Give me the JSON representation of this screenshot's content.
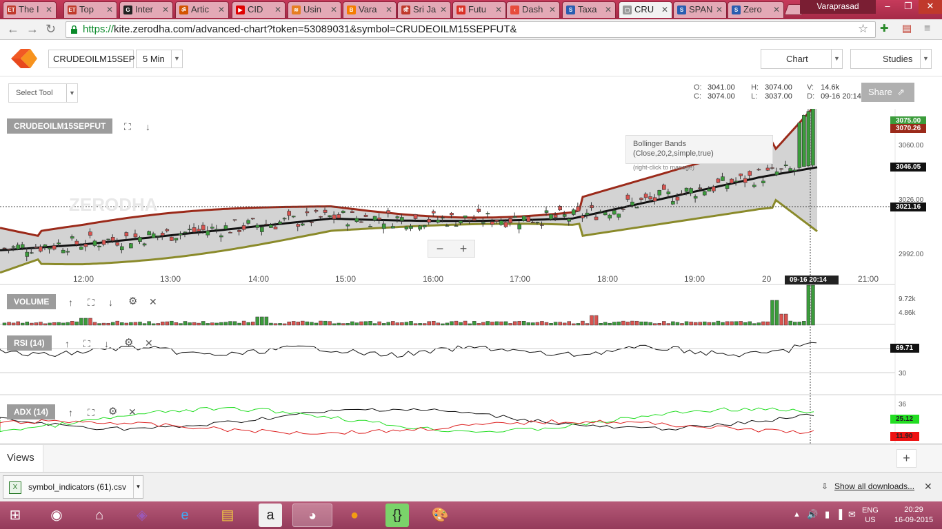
{
  "browser": {
    "tabs": [
      {
        "label": "The I",
        "icon": "ET",
        "color": "#c0392b"
      },
      {
        "label": "Top",
        "icon": "ET",
        "color": "#c0392b"
      },
      {
        "label": "Inter",
        "icon": "G",
        "color": "#222222"
      },
      {
        "label": "Artic",
        "icon": "ॐ",
        "color": "#d35400"
      },
      {
        "label": "CID",
        "icon": "▶",
        "color": "#e00000"
      },
      {
        "label": "Usin",
        "icon": "≋",
        "color": "#e67e22"
      },
      {
        "label": "Vara",
        "icon": "B",
        "color": "#f57d00"
      },
      {
        "label": "Sri Ja",
        "icon": "श्री",
        "color": "#c0392b"
      },
      {
        "label": "Futu",
        "icon": "M",
        "color": "#d93025"
      },
      {
        "label": "Dash",
        "icon": "‹",
        "color": "#e74c3c"
      },
      {
        "label": "Taxa",
        "icon": "S",
        "color": "#2a5db0"
      },
      {
        "label": "CRU",
        "icon": "▢",
        "color": "#999999"
      },
      {
        "label": "SPAN",
        "icon": "S",
        "color": "#2a5db0"
      },
      {
        "label": "Zero",
        "icon": "S",
        "color": "#2a5db0"
      }
    ],
    "user": "Varaprasad",
    "url_scheme": "https://",
    "url_rest": "kite.zerodha.com/advanced-chart?token=53089031&symbol=CRUDEOILM15SEPFUT&"
  },
  "app": {
    "symbol_input": "CRUDEOILM15SEP",
    "interval": "5 Min",
    "chart_btn": "Chart",
    "studies_btn": "Studies",
    "select_tool": "Select Tool",
    "share": "Share",
    "ohlc": {
      "o_label": "O:",
      "o": "3041.00",
      "h_label": "H:",
      "h": "3074.00",
      "v_label": "V:",
      "v": "14.6k",
      "c_label": "C:",
      "c": "3074.00",
      "l_label": "L:",
      "l": "3037.00",
      "d_label": "D:",
      "d": "09-16 20:14"
    },
    "panels": {
      "main": "CRUDEOILM15SEPFUT",
      "volume": "VOLUME",
      "rsi": "RSI (14)",
      "adx": "ADX (14)"
    },
    "tooltip": {
      "title": "Bollinger Bands (Close,20,2,simple,true)",
      "sub": "(right-click to manage)"
    },
    "zoom_minus": "−",
    "zoom_plus": "+",
    "views": "Views",
    "add_view": "+"
  },
  "chart_data": {
    "type": "candlestick",
    "time_labels": [
      "12:00",
      "13:00",
      "14:00",
      "15:00",
      "16:00",
      "17:00",
      "18:00",
      "19:00",
      "20",
      "21:00"
    ],
    "price_ticks": [
      "3060.00",
      "3026.00",
      "2992.00"
    ],
    "price_tags": {
      "last": "3075.00",
      "upper_band": "3070.26",
      "middle_band": "3046.05",
      "crosshair": "3021.16"
    },
    "crosshair_time": "09-16 20:14",
    "volume_ticks": [
      "9.72k",
      "4.86k"
    ],
    "rsi_ticks": [
      "30"
    ],
    "rsi_value": "69.71",
    "adx_ticks": [
      "36"
    ],
    "adx_value_green": "25.12",
    "adx_value_red": "11.90",
    "colors": {
      "up": "#3b9c3b",
      "down": "#d9534f",
      "upper": "#9b2a1a",
      "lower": "#8a8a2a",
      "middle": "#111111"
    }
  },
  "downloads": {
    "file": "symbol_indicators (61).csv",
    "show_all": "Show all downloads..."
  },
  "taskbar": {
    "lang": "ENG",
    "region": "US",
    "time": "20:29",
    "date": "16-09-2015"
  }
}
